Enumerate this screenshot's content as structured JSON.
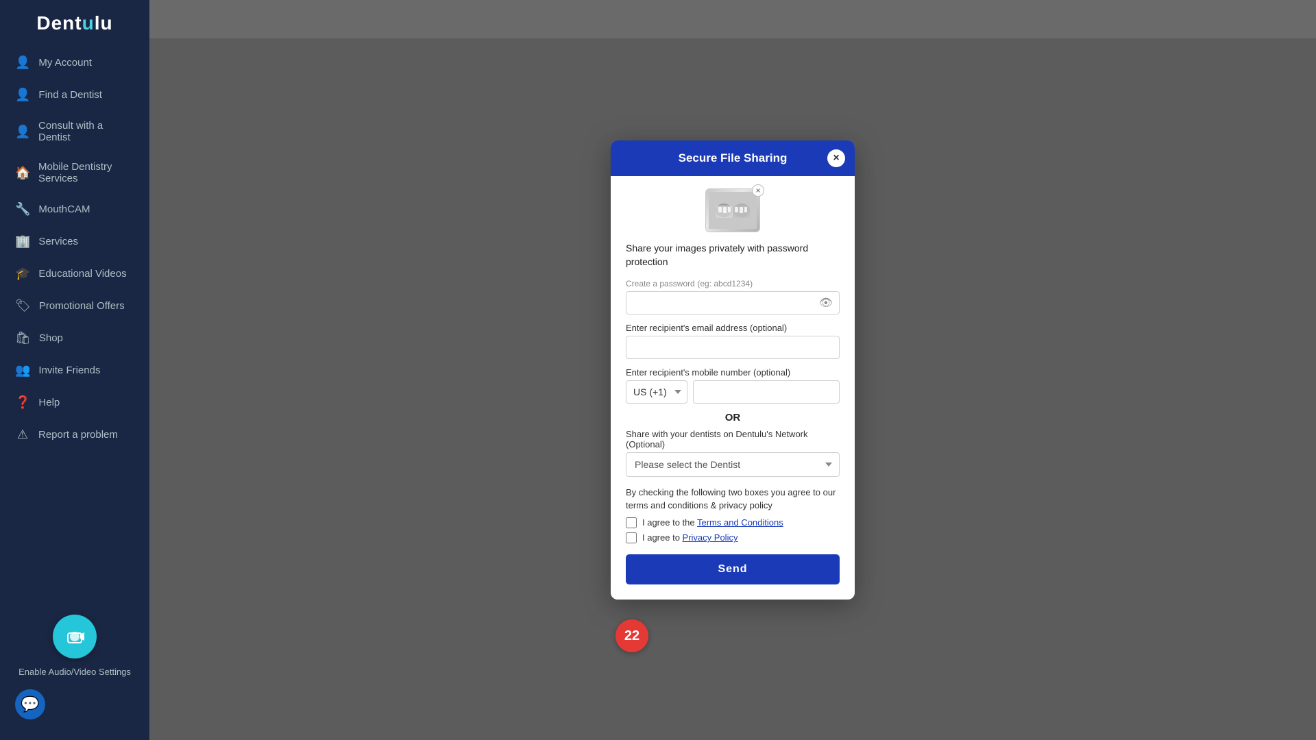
{
  "app": {
    "name": "Dentulu",
    "logo_dot": "."
  },
  "sidebar": {
    "items": [
      {
        "id": "my-account",
        "label": "My Account",
        "icon": "👤"
      },
      {
        "id": "find-dentist",
        "label": "Find a Dentist",
        "icon": "👤"
      },
      {
        "id": "consult-dentist",
        "label": "Consult with a Dentist",
        "icon": "👤"
      },
      {
        "id": "mobile-dentistry",
        "label": "Mobile Dentistry Services",
        "icon": "🏠"
      },
      {
        "id": "mouthcam",
        "label": "MouthCAM",
        "icon": "🔧"
      },
      {
        "id": "services",
        "label": "Services",
        "icon": "🏢"
      },
      {
        "id": "educational-videos",
        "label": "Educational Videos",
        "icon": "🎓"
      },
      {
        "id": "promotional-offers",
        "label": "Promotional Offers",
        "icon": "🏷"
      },
      {
        "id": "shop",
        "label": "Shop",
        "icon": "🛍"
      },
      {
        "id": "invite-friends",
        "label": "Invite Friends",
        "icon": "👥"
      },
      {
        "id": "help",
        "label": "Help",
        "icon": "❓"
      },
      {
        "id": "report-problem",
        "label": "Report a problem",
        "icon": "⚠"
      }
    ],
    "bottom": {
      "cam_label": "Enable Audio/Video Settings"
    }
  },
  "modal": {
    "title": "Secure File Sharing",
    "close_label": "×",
    "share_desc": "Share your images privately with password protection",
    "password_label": "Create a password",
    "password_placeholder": "eg: abcd1234",
    "email_label": "Enter recipient's email address (optional)",
    "email_placeholder": "",
    "phone_label": "Enter recipient's mobile number (optional)",
    "phone_country": "US (+1)",
    "phone_placeholder": "",
    "or_text": "OR",
    "dentist_label": "Share with your dentists on Dentulu's Network (Optional)",
    "dentist_placeholder": "Please select the Dentist",
    "terms_text": "By checking the following two boxes you agree to our terms and conditions & privacy policy",
    "terms_check1": "I agree to the ",
    "terms_link1": "Terms and Conditions",
    "terms_check2": "I agree to ",
    "terms_link2": "Privacy Policy",
    "send_label": "Send"
  },
  "notification": {
    "badge_count": "22"
  }
}
